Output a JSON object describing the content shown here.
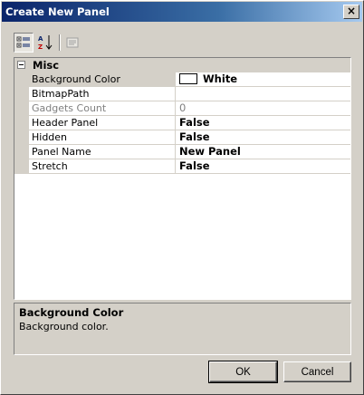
{
  "window": {
    "title": "Create New Panel",
    "close_label": "×"
  },
  "toolbar": {
    "categorized_icon": "categorized-icon",
    "alphabetical_icon": "alphabetical-sort-icon",
    "property_pages_icon": "property-pages-icon"
  },
  "grid": {
    "category": "Misc",
    "properties": [
      {
        "name": "Background Color",
        "value": "White",
        "swatch": "#ffffff"
      },
      {
        "name": "BitmapPath",
        "value": ""
      },
      {
        "name": "Gadgets Count",
        "value": "0"
      },
      {
        "name": "Header Panel",
        "value": "False"
      },
      {
        "name": "Hidden",
        "value": "False"
      },
      {
        "name": "Panel Name",
        "value": "New Panel"
      },
      {
        "name": "Stretch",
        "value": "False"
      }
    ]
  },
  "description": {
    "title": "Background Color",
    "text": "Background color."
  },
  "buttons": {
    "ok": "OK",
    "cancel": "Cancel"
  },
  "colors": {
    "titlebar_start": "#0a246a",
    "titlebar_end": "#a6caf0",
    "face": "#d4d0c8"
  }
}
